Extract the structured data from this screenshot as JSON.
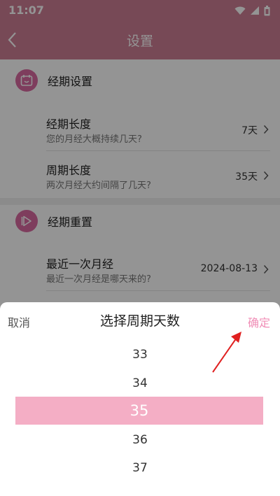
{
  "status_bar": {
    "time": "11:07",
    "icons": [
      "wifi-icon",
      "signal-icon",
      "battery-icon"
    ]
  },
  "header": {
    "title": "设置",
    "back_icon": "chevron-left-icon"
  },
  "sections": [
    {
      "title": "经期设置",
      "icon": "calendar-icon",
      "items": [
        {
          "title": "经期长度",
          "subtitle": "您的月经大概持续几天?",
          "value": "7天"
        },
        {
          "title": "周期长度",
          "subtitle": "两次月经大约间隔了几天?",
          "value": "35天"
        }
      ]
    },
    {
      "title": "经期重置",
      "icon": "play-icon",
      "items": [
        {
          "title": "最近一次月经",
          "subtitle": "最近一次月经是哪天来的?",
          "value": "2024-08-13"
        }
      ]
    }
  ],
  "picker": {
    "cancel_label": "取消",
    "title": "选择周期天数",
    "confirm_label": "确定",
    "options": [
      "33",
      "34",
      "35",
      "36",
      "37"
    ],
    "selected": "35"
  },
  "colors": {
    "header": "#ce7e94",
    "section_icon": "#d96aa0",
    "selection": "#f4aec5",
    "confirm": "#f08db6",
    "annotation_arrow": "#e02020"
  }
}
